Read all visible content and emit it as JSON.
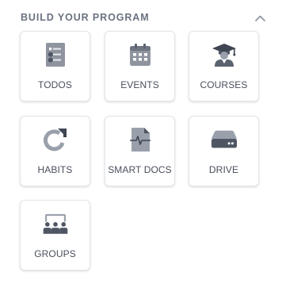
{
  "section": {
    "title": "BUILD YOUR PROGRAM",
    "collapse_icon": "chevron-up-icon"
  },
  "colors": {
    "icon_dark": "#5b6270",
    "icon_light": "#9aa0ab",
    "label": "#4a4f5c",
    "heading": "#6b7180",
    "card_border": "#e4e6ea"
  },
  "tiles": [
    {
      "label": "TODOS",
      "icon": "checklist-icon"
    },
    {
      "label": "EVENTS",
      "icon": "calendar-icon"
    },
    {
      "label": "COURSES",
      "icon": "graduate-icon"
    },
    {
      "label": "HABITS",
      "icon": "refresh-arrow-icon"
    },
    {
      "label": "SMART DOCS",
      "icon": "document-pulse-icon"
    },
    {
      "label": "DRIVE",
      "icon": "hard-drive-icon"
    },
    {
      "label": "GROUPS",
      "icon": "group-presentation-icon"
    }
  ]
}
